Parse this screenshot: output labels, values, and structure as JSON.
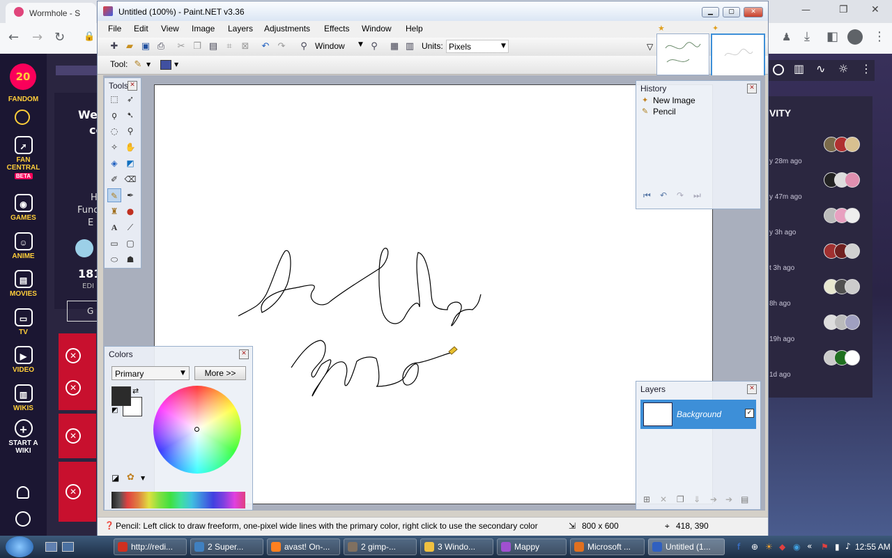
{
  "browser": {
    "tab_title": "Wormhole - S",
    "window_controls": [
      "—",
      "❐",
      "✕"
    ]
  },
  "fandom_rail": {
    "badge": "20",
    "brand": "FANDOM",
    "items": [
      "FAN CENTRAL",
      "GAMES",
      "ANIME",
      "MOVIES",
      "TV",
      "VIDEO",
      "WIKIS",
      "START A WIKI"
    ],
    "beta": "BETA"
  },
  "wiki": {
    "welcome": "We",
    "welcome2": "co",
    "line_h": "H",
    "line_func": "Func",
    "line_e": "E",
    "count": "181",
    "edi": "EDI",
    "btn": "G",
    "activity_title": "VITY",
    "activity": [
      {
        "time": "y 28m ago",
        "colors": [
          "#7a6a4a",
          "#b03030",
          "#d8c090"
        ]
      },
      {
        "time": "y 47m ago",
        "colors": [
          "#222",
          "#dddddd",
          "#e090b0"
        ]
      },
      {
        "time": "y 3h ago",
        "colors": [
          "#bbbbbb",
          "#e8a0c0",
          "#eeeeee"
        ]
      },
      {
        "time": "t 3h ago",
        "colors": [
          "#a03030",
          "#702020",
          "#d0d0d0"
        ]
      },
      {
        "time": "8h ago",
        "colors": [
          "#e8e8d0",
          "#505050",
          "#cccccc"
        ]
      },
      {
        "time": "19h ago",
        "colors": [
          "#dddddd",
          "#bbbbbb",
          "#a0a0c0"
        ]
      },
      {
        "time": "1d ago",
        "colors": [
          "#cccccc",
          "#207020",
          "#ffffff"
        ]
      }
    ]
  },
  "paintnet": {
    "title": "Untitled (100%) - Paint.NET v3.36",
    "menu": [
      "File",
      "Edit",
      "View",
      "Image",
      "Layers",
      "Adjustments",
      "Effects",
      "Window",
      "Help"
    ],
    "zoom_value": "Window",
    "units_label": "Units:",
    "units_value": "Pixels",
    "tool_label": "Tool:",
    "tools_title": "Tools",
    "history": {
      "title": "History",
      "items": [
        "New Image",
        "Pencil"
      ]
    },
    "layers": {
      "title": "Layers",
      "items": [
        "Background"
      ]
    },
    "colors": {
      "title": "Colors",
      "mode": "Primary",
      "more": "More >>",
      "primary": "#2b2b2b",
      "secondary": "#ffffff"
    },
    "status": {
      "hint": "Pencil: Left click to draw freeform, one-pixel wide lines with the primary color, right click to use the secondary color",
      "size": "800 x 600",
      "pos": "418, 390"
    }
  },
  "taskbar": {
    "buttons": [
      {
        "label": "http://redi...",
        "color": "#d03020"
      },
      {
        "label": "2 Super...",
        "color": "#4080c0"
      },
      {
        "label": "avast! On-...",
        "color": "#ff8020"
      },
      {
        "label": "2 gimp-...",
        "color": "#807060"
      },
      {
        "label": "3 Windo...",
        "color": "#f0c040"
      },
      {
        "label": "Mappy",
        "color": "#a050d0"
      },
      {
        "label": "Microsoft ...",
        "color": "#e07020"
      },
      {
        "label": "Untitled (1...",
        "color": "#3060c0"
      }
    ],
    "clock": "12:55 AM"
  }
}
